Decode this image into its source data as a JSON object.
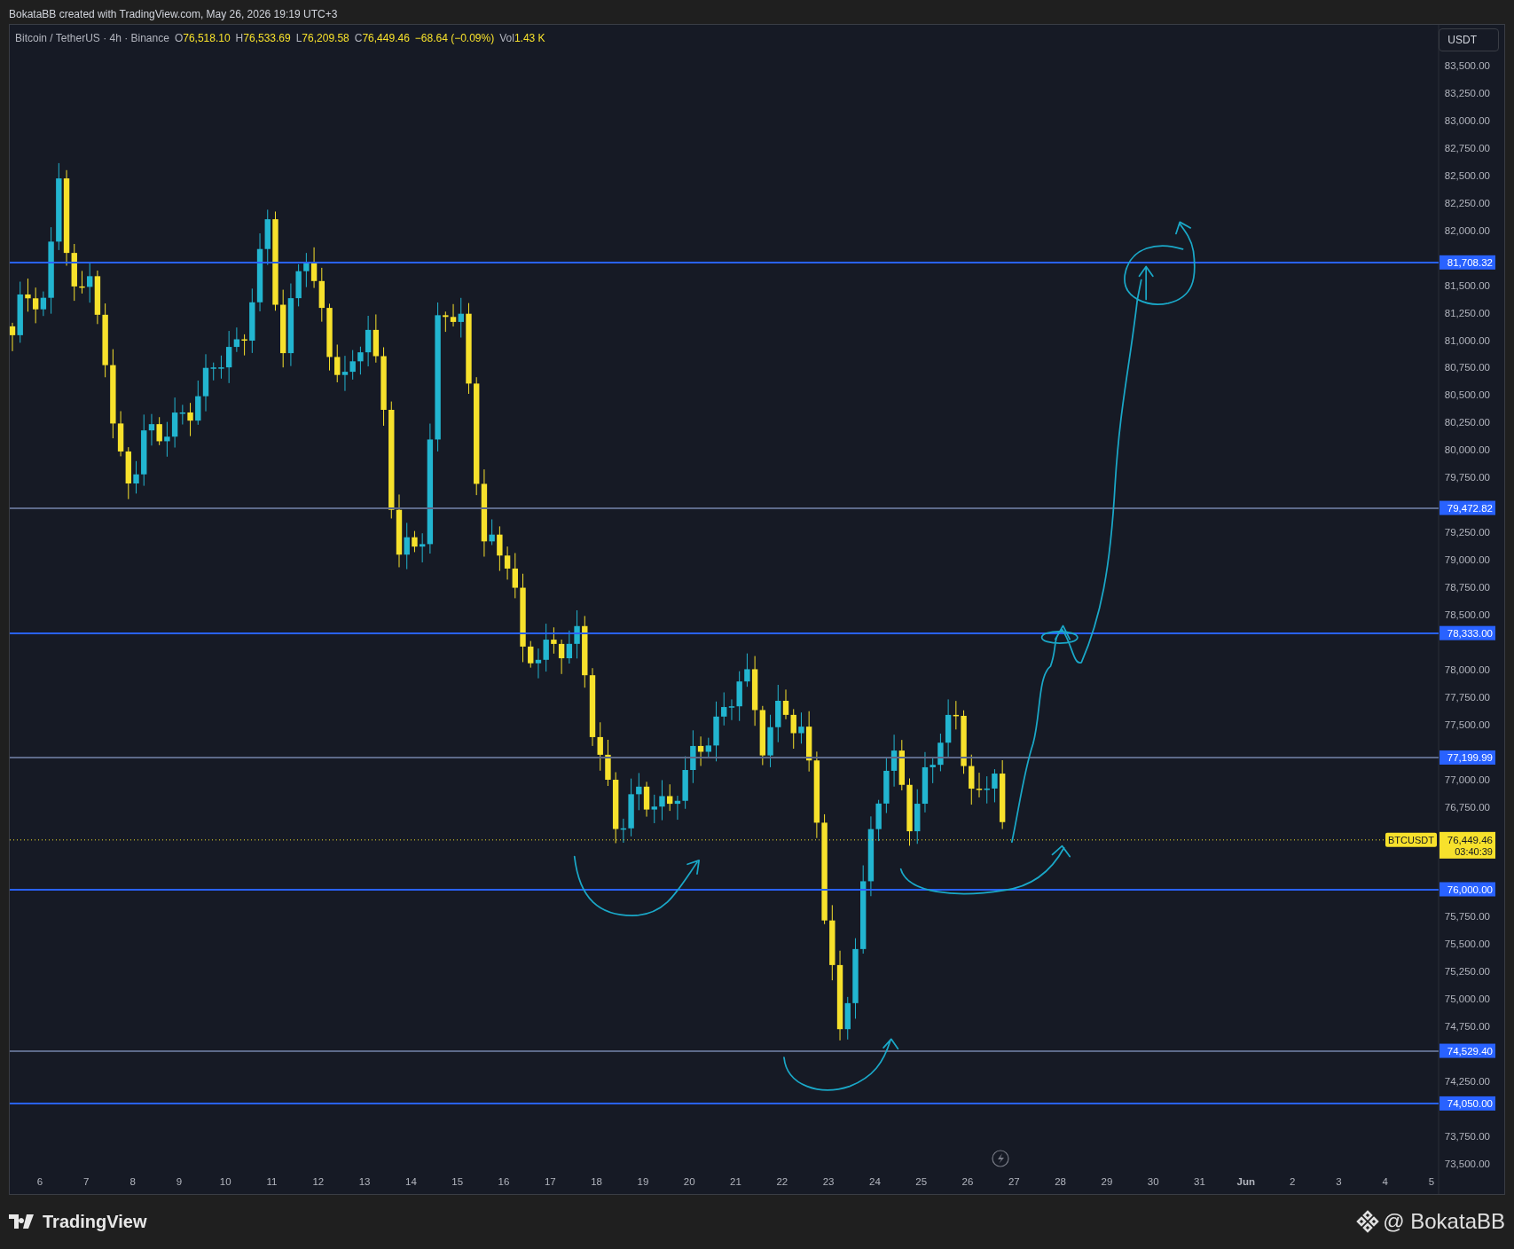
{
  "header": {
    "credit": "BokataBB created with TradingView.com, May 26, 2026 19:19 UTC+3"
  },
  "legend": {
    "symbol": "Bitcoin / TetherUS · 4h · Binance",
    "open_label": "O",
    "open": "76,518.10",
    "high_label": "H",
    "high": "76,533.69",
    "low_label": "L",
    "low": "76,209.58",
    "close_label": "C",
    "close": "76,449.46",
    "change": "−68.64 (−0.09%)",
    "volume_label": "Vol",
    "volume": "1.43 K"
  },
  "currency_button": "USDT",
  "price_axis": [
    "83,500.00",
    "83,250.00",
    "83,000.00",
    "82,750.00",
    "82,500.00",
    "82,250.00",
    "82,000.00",
    "81,500.00",
    "81,250.00",
    "81,000.00",
    "80,750.00",
    "80,500.00",
    "80,250.00",
    "80,000.00",
    "79,750.00",
    "79,250.00",
    "79,000.00",
    "78,750.00",
    "78,500.00",
    "78,000.00",
    "77,750.00",
    "77,500.00",
    "77,000.00",
    "76,750.00",
    "75,750.00",
    "75,500.00",
    "75,250.00",
    "75,000.00",
    "74,750.00",
    "74,250.00",
    "73,750.00",
    "73,500.00"
  ],
  "date_axis": [
    "6",
    "7",
    "8",
    "9",
    "10",
    "11",
    "12",
    "13",
    "14",
    "15",
    "16",
    "17",
    "18",
    "19",
    "20",
    "21",
    "22",
    "23",
    "24",
    "25",
    "26",
    "27",
    "28",
    "29",
    "30",
    "31",
    "Jun",
    "2",
    "3",
    "4",
    "5"
  ],
  "levels": [
    {
      "label": "81,708.32",
      "color": "#2962ff"
    },
    {
      "label": "79,472.82",
      "color": "#5d6a8a"
    },
    {
      "label": "78,333.00",
      "color": "#2962ff"
    },
    {
      "label": "77,199.99",
      "color": "#5d6a8a"
    },
    {
      "label": "76,000.00",
      "color": "#2962ff"
    },
    {
      "label": "74,529.40",
      "color": "#5d6a8a"
    },
    {
      "label": "74,050.00",
      "color": "#2962ff"
    }
  ],
  "last_price": {
    "symbol": "BTCUSDT",
    "price": "76,449.46",
    "countdown": "03:40:39"
  },
  "footer": {
    "brand": "TradingView",
    "author": "@ BokataBB"
  }
}
